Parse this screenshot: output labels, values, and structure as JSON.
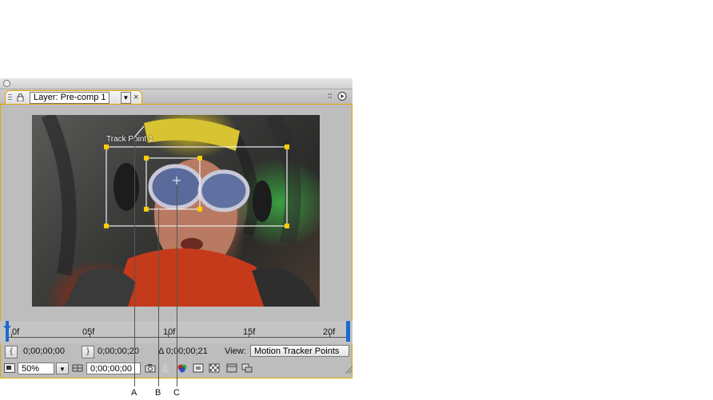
{
  "panel": {
    "tab_title": "Layer: Pre-comp 1",
    "tab_dropdown": "▼",
    "tab_close": "×"
  },
  "viewer": {
    "track_point_label": "Track Point 1"
  },
  "timeline": {
    "ticks": [
      "0f",
      "05f",
      "10f",
      "15f",
      "20f"
    ]
  },
  "controls": {
    "in_button": "{",
    "in_time": "0;00;00;00",
    "out_button": "}",
    "out_time": "0;00;00;20",
    "duration": "Δ 0;00;00;21",
    "view_label": "View:",
    "view_value": "Motion Tracker Points",
    "zoom_value": "50%",
    "zoom_dropdown": "▼",
    "current_time": "0;00;00;00"
  },
  "callouts": {
    "a": "A",
    "b": "B",
    "c": "C"
  },
  "colors": {
    "panel_highlight": "#e0a800",
    "track_point": "#ffcc00",
    "track_box": "#ffffff"
  }
}
